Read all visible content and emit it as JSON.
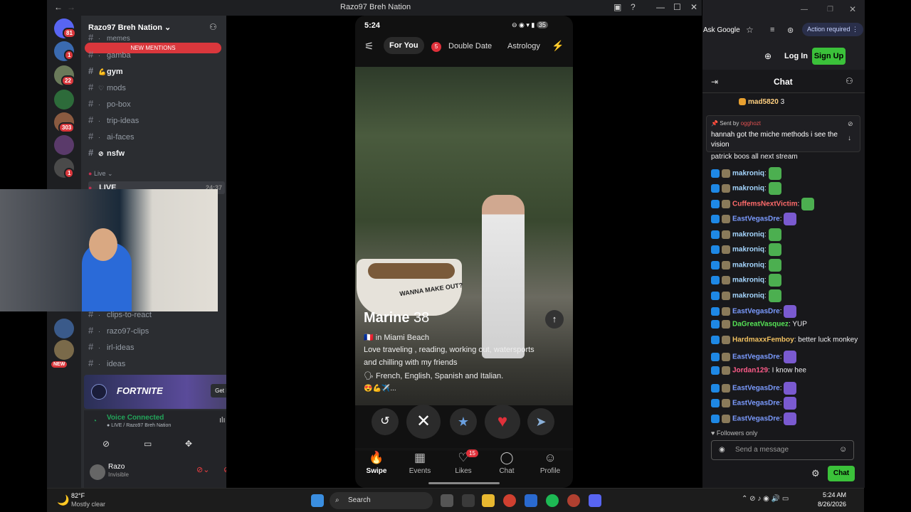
{
  "discord": {
    "window_title": "Razo97 Breh Nation",
    "server_name": "Razo97 Breh Nation",
    "new_mentions": "NEW MENTIONS",
    "server_badges": [
      "81",
      "1",
      "22",
      "303",
      "1"
    ],
    "new_badge": "NEW",
    "channels": [
      {
        "name": "memes",
        "bold": false
      },
      {
        "name": "gamba",
        "bold": false
      },
      {
        "name": "gym",
        "bold": true
      },
      {
        "name": "mods",
        "bold": false
      },
      {
        "name": "po-box",
        "bold": false
      },
      {
        "name": "trip-ideas",
        "bold": false
      },
      {
        "name": "ai-faces",
        "bold": false
      },
      {
        "name": "nsfw",
        "bold": true
      }
    ],
    "live_category": "Live",
    "live_channel": "LIVE",
    "live_time": "24:37",
    "channels2": [
      "clips-to-react",
      "razo97-clips",
      "irl-ideas",
      "ideas"
    ],
    "promo_title": "FORTNITE",
    "promo_button": "Get Reward!",
    "voice_status": "Voice Connected",
    "voice_channel": "LIVE / Razo97 Breh Nation",
    "user_name": "Razo",
    "user_status": "Invisible"
  },
  "phone": {
    "time": "5:24",
    "battery": "35",
    "tabs": [
      "For You",
      "Double Date",
      "Astrology"
    ],
    "double_date_count": "5",
    "profile_name": "Marine",
    "profile_age": "38",
    "location": "in Miami Beach",
    "bio1": "Love traveling , reading, working out, watersports",
    "bio2": "and chilling with my friends",
    "languages": "French, English, Spanish and Italian.",
    "tub_text": "WANNA MAKE OUT?",
    "nav": [
      {
        "label": "Swipe",
        "icon": "flame-icon"
      },
      {
        "label": "Events",
        "icon": "calendar-icon"
      },
      {
        "label": "Likes",
        "icon": "heart-icon"
      },
      {
        "label": "Chat",
        "icon": "chat-icon"
      },
      {
        "label": "Profile",
        "icon": "person-icon"
      }
    ],
    "likes_badge": "15"
  },
  "browser": {
    "ask_google": "Ask Google",
    "action_required": "Action required",
    "login": "Log In",
    "signup": "Sign Up",
    "chat_title": "Chat"
  },
  "chat": {
    "top_user": "mad5820",
    "top_count": "3",
    "pinned_label": "Sent by",
    "pinned_user": "ogghozt",
    "pinned_text1": "hannah got the miche methods i see the",
    "pinned_text2": "vision",
    "first_msg": "patrick boos all next stream",
    "messages": [
      {
        "user": "makroniq",
        "color": "#a5d6ff",
        "text": ""
      },
      {
        "user": "makroniq",
        "color": "#a5d6ff",
        "text": ""
      },
      {
        "user": "CuffemsNextVictim",
        "color": "#ff6b6b",
        "text": ""
      },
      {
        "user": "EastVegasDre",
        "color": "#7b9bff",
        "text": ""
      },
      {
        "user": "makroniq",
        "color": "#a5d6ff",
        "text": ""
      },
      {
        "user": "makroniq",
        "color": "#a5d6ff",
        "text": ""
      },
      {
        "user": "makroniq",
        "color": "#a5d6ff",
        "text": ""
      },
      {
        "user": "makroniq",
        "color": "#a5d6ff",
        "text": ""
      },
      {
        "user": "makroniq",
        "color": "#a5d6ff",
        "text": ""
      },
      {
        "user": "EastVegasDre",
        "color": "#7b9bff",
        "text": ""
      },
      {
        "user": "DaGreatVasquez",
        "color": "#56e356",
        "text": "YUP"
      },
      {
        "user": "HardmaxxFemboy",
        "color": "#f0c060",
        "text": "better luck monkey"
      },
      {
        "user": "EastVegasDre",
        "color": "#7b9bff",
        "text": ""
      },
      {
        "user": "Jordan129",
        "color": "#ff5c8a",
        "text": "I know hee"
      },
      {
        "user": "EastVegasDre",
        "color": "#7b9bff",
        "text": ""
      },
      {
        "user": "EastVegasDre",
        "color": "#7b9bff",
        "text": ""
      },
      {
        "user": "EastVegasDre",
        "color": "#7b9bff",
        "text": ""
      }
    ],
    "followers_only": "Followers only",
    "send_placeholder": "Send a message",
    "chat_button": "Chat"
  },
  "taskbar": {
    "temp": "82°F",
    "weather": "Mostly clear",
    "search": "Search",
    "time": "5:24 AM",
    "date": "8/26/2026"
  }
}
